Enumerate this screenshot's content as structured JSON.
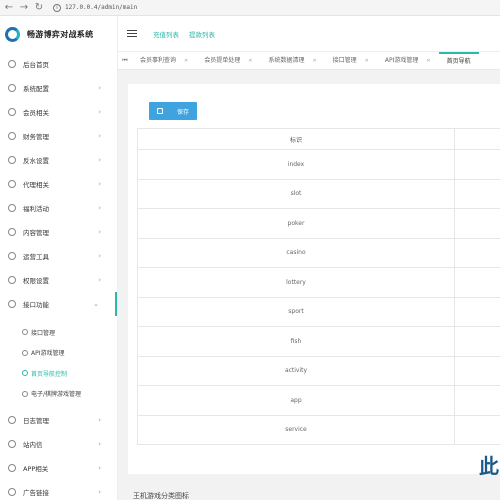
{
  "browser": {
    "url": "127.0.0.4/admin/main",
    "back": "←",
    "forward": "→",
    "reload": "↻",
    "info": "i"
  },
  "app": {
    "title": "畅游博弈对战系统"
  },
  "header": {
    "links": [
      "充值列表",
      "提款列表"
    ]
  },
  "sidebar": {
    "items": [
      {
        "label": "后台首页",
        "arrow": ""
      },
      {
        "label": "系统配置",
        "arrow": "›"
      },
      {
        "label": "会员相关",
        "arrow": "›"
      },
      {
        "label": "财务管理",
        "arrow": "›"
      },
      {
        "label": "反水设置",
        "arrow": "›"
      },
      {
        "label": "代理相关",
        "arrow": "›"
      },
      {
        "label": "福利活动",
        "arrow": "›"
      },
      {
        "label": "内容管理",
        "arrow": "›"
      },
      {
        "label": "运营工具",
        "arrow": "›"
      },
      {
        "label": "权限设置",
        "arrow": "›"
      },
      {
        "label": "接口功能",
        "arrow": "⌄"
      }
    ],
    "sub_items": [
      {
        "label": "接口管理"
      },
      {
        "label": "API游戏管理"
      },
      {
        "label": "首页导航控制"
      },
      {
        "label": "电子/棋牌游戏管理"
      }
    ],
    "bottom_items": [
      {
        "label": "日志管理",
        "arrow": "›"
      },
      {
        "label": "站内信",
        "arrow": "›"
      },
      {
        "label": "APP相关",
        "arrow": "›"
      },
      {
        "label": "广告链接",
        "arrow": "›"
      }
    ]
  },
  "tabs": {
    "scroll_left": "⏮",
    "items": [
      "会员事利查询",
      "会员提单处理",
      "系统数据清理",
      "接口管理",
      "API游戏管理",
      "首页导航"
    ]
  },
  "main": {
    "save_label": "保存",
    "table": {
      "header": "标识",
      "rows": [
        "index",
        "slot",
        "poker",
        "casino",
        "lottery",
        "sport",
        "fish",
        "activity",
        "app",
        "service"
      ]
    },
    "partial_char": "此",
    "bottom_text": "王机游戏分类图标"
  },
  "colors": {
    "accent": "#2ab8a8",
    "primary_button": "#3fa3e0",
    "logo": "#1f6fb2"
  }
}
